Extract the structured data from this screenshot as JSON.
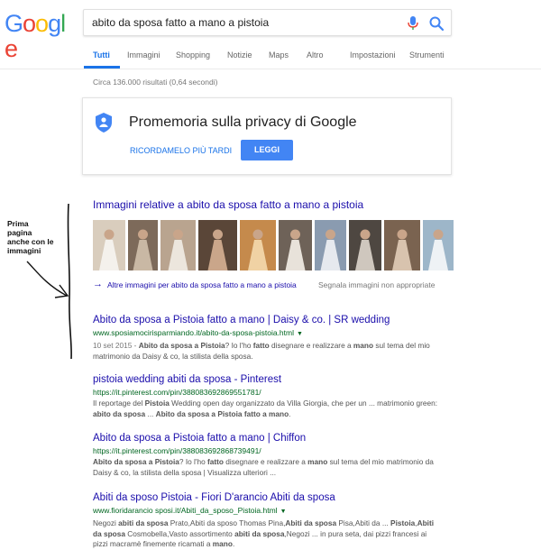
{
  "logo": {
    "letters": [
      {
        "ch": "G",
        "color": "#4285F4"
      },
      {
        "ch": "o",
        "color": "#EA4335"
      },
      {
        "ch": "o",
        "color": "#FBBC05"
      },
      {
        "ch": "g",
        "color": "#4285F4"
      },
      {
        "ch": "l",
        "color": "#34A853"
      },
      {
        "ch": "e",
        "color": "#EA4335"
      }
    ]
  },
  "search": {
    "query": "abito da sposa fatto a mano a pistoia",
    "icons": [
      "mic-icon",
      "search-icon"
    ]
  },
  "tabs": [
    {
      "label": "Tutti",
      "active": true
    },
    {
      "label": "Immagini",
      "active": false
    },
    {
      "label": "Shopping",
      "active": false
    },
    {
      "label": "Notizie",
      "active": false
    },
    {
      "label": "Maps",
      "active": false
    },
    {
      "label": "Altro",
      "active": false
    },
    {
      "label": "Impostazioni",
      "active": false
    },
    {
      "label": "Strumenti",
      "active": false
    }
  ],
  "stats": "Circa 136.000 risultati (0,64 secondi)",
  "privacy": {
    "title": "Promemoria sulla privacy di Google",
    "remind_later": "RICORDAMELO PIÙ TARDI",
    "read": "LEGGI"
  },
  "annotation": {
    "lines": [
      "Prima",
      "pagina",
      "anche con le",
      "immagini"
    ]
  },
  "images": {
    "heading": "Immagini relative a abito da sposa fatto a mano a pistoia",
    "thumbnails": [
      "bride-white-dress-indoor",
      "couple-wedding",
      "bride-veil-portrait",
      "bride-closeup-portrait",
      "bride-sunset-field",
      "bride-lace-gown",
      "bride-long-train",
      "bride-pearl-necklace",
      "woman-smiling-portrait",
      "bride-beach-dress"
    ],
    "more_arrow": "→",
    "more": "Altre immagini per abito da sposa fatto a mano a pistoia",
    "report": "Segnala immagini non appropriate"
  },
  "results": [
    {
      "title": "Abito da sposa a Pistoia fatto a mano | Daisy & co. | SR wedding",
      "url": "www.sposiamocirisparmiando.it/abito-da-sposa-pistoia.html",
      "snippet": [
        [
          {
            "t": "10 set 2015",
            "k": "date"
          },
          {
            "t": " - ",
            "k": "date"
          },
          {
            "t": "Abito da sposa a Pistoia",
            "k": "b"
          },
          {
            "t": "? Io l'ho ",
            "k": "n"
          },
          {
            "t": "fatto",
            "k": "b"
          },
          {
            "t": " disegnare e realizzare a ",
            "k": "n"
          },
          {
            "t": "mano",
            "k": "b"
          },
          {
            "t": " sul tema del mio",
            "k": "n"
          }
        ],
        [
          {
            "t": "matrimonio da Daisy & co, la stilista della sposa.",
            "k": "n"
          }
        ]
      ]
    },
    {
      "title": "pistoia wedding abiti da sposa - Pinterest",
      "url": "https://it.pinterest.com/pin/388083692869551781/",
      "snippet": [
        [
          {
            "t": "Il reportage del ",
            "k": "n"
          },
          {
            "t": "Pistoia",
            "k": "b"
          },
          {
            "t": " Wedding open day organizzato da Villa Giorgia, che per un ... matrimonio green:",
            "k": "n"
          }
        ],
        [
          {
            "t": "abito da sposa",
            "k": "b"
          },
          {
            "t": " ... ",
            "k": "n"
          },
          {
            "t": "Abito da sposa a Pistoia fatto a mano",
            "k": "b"
          },
          {
            "t": ".",
            "k": "n"
          }
        ]
      ]
    },
    {
      "title": "Abito da sposa a Pistoia fatto a mano | Chiffon",
      "url": "https://it.pinterest.com/pin/388083692868739491/",
      "snippet": [
        [
          {
            "t": "Abito da sposa a Pistoia",
            "k": "b"
          },
          {
            "t": "? Io l'ho ",
            "k": "n"
          },
          {
            "t": "fatto",
            "k": "b"
          },
          {
            "t": " disegnare e realizzare a ",
            "k": "n"
          },
          {
            "t": "mano",
            "k": "b"
          },
          {
            "t": " sul tema del mio matrimonio da",
            "k": "n"
          }
        ],
        [
          {
            "t": "Daisy & co, la stilista della sposa | Visualizza ulteriori ...",
            "k": "n"
          }
        ]
      ]
    },
    {
      "title": "Abiti da sposo Pistoia - Fiori D'arancio Abiti da sposa",
      "url": "www.fioridarancio sposi.it/Abiti_da_sposo_Pistoia.html",
      "snippet": [
        [
          {
            "t": "Negozi ",
            "k": "n"
          },
          {
            "t": "abiti da sposa",
            "k": "b"
          },
          {
            "t": " Prato,Abiti da sposo Thomas Pina,",
            "k": "n"
          },
          {
            "t": "Abiti da sposa",
            "k": "b"
          },
          {
            "t": " Pisa,Abiti da ... ",
            "k": "n"
          },
          {
            "t": "Pistoia",
            "k": "b"
          },
          {
            "t": ",",
            "k": "n"
          },
          {
            "t": "Abiti",
            "k": "b"
          }
        ],
        [
          {
            "t": "da sposa",
            "k": "b"
          },
          {
            "t": " Cosmobella,Vasto assortimento ",
            "k": "n"
          },
          {
            "t": "abiti da sposa",
            "k": "b"
          },
          {
            "t": ",Negozi ... in pura seta, dai pizzi francesi ai",
            "k": "n"
          }
        ],
        [
          {
            "t": "pizzi macramè finemente ricamati a ",
            "k": "n"
          },
          {
            "t": "mano",
            "k": "b"
          },
          {
            "t": ".",
            "k": "n"
          }
        ]
      ]
    }
  ],
  "colors": {
    "link": "#1a0dab",
    "url": "#006621",
    "snippet": "#545454",
    "accent": "#1a73e8",
    "button": "#4285f4"
  }
}
